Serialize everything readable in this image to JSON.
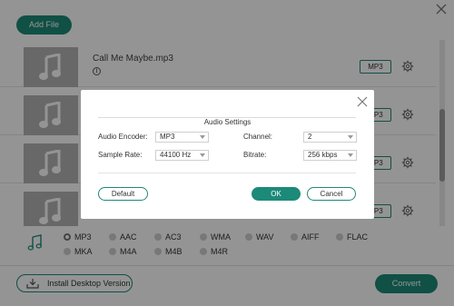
{
  "toolbar": {
    "add_file_label": "Add File"
  },
  "files": [
    {
      "name": "Call Me Maybe.mp3",
      "format": "MP3"
    },
    {
      "name": "",
      "format": "MP3"
    },
    {
      "name": "",
      "format": "MP3"
    },
    {
      "name": "",
      "format": "MP3"
    }
  ],
  "formats": {
    "selected": "MP3",
    "row1": [
      "MP3",
      "AAC",
      "AC3",
      "WMA",
      "WAV",
      "AIFF",
      "FLAC"
    ],
    "row2": [
      "MKA",
      "M4A",
      "M4B",
      "M4R"
    ]
  },
  "footer": {
    "install_label": "Install Desktop Version",
    "convert_label": "Convert"
  },
  "dialog": {
    "title": "Audio Settings",
    "encoder_label": "Audio Encoder:",
    "encoder_value": "MP3",
    "channel_label": "Channel:",
    "channel_value": "2",
    "sample_rate_label": "Sample Rate:",
    "sample_rate_value": "44100 Hz",
    "bitrate_label": "Bitrate:",
    "bitrate_value": "256 kbps",
    "default_label": "Default",
    "ok_label": "OK",
    "cancel_label": "Cancel"
  },
  "colors": {
    "accent": "#1c8a78",
    "overlay": "rgba(0,0,0,0.42)"
  },
  "icons": [
    "close-icon",
    "music-note-icon",
    "info-icon",
    "gear-icon",
    "download-icon"
  ]
}
